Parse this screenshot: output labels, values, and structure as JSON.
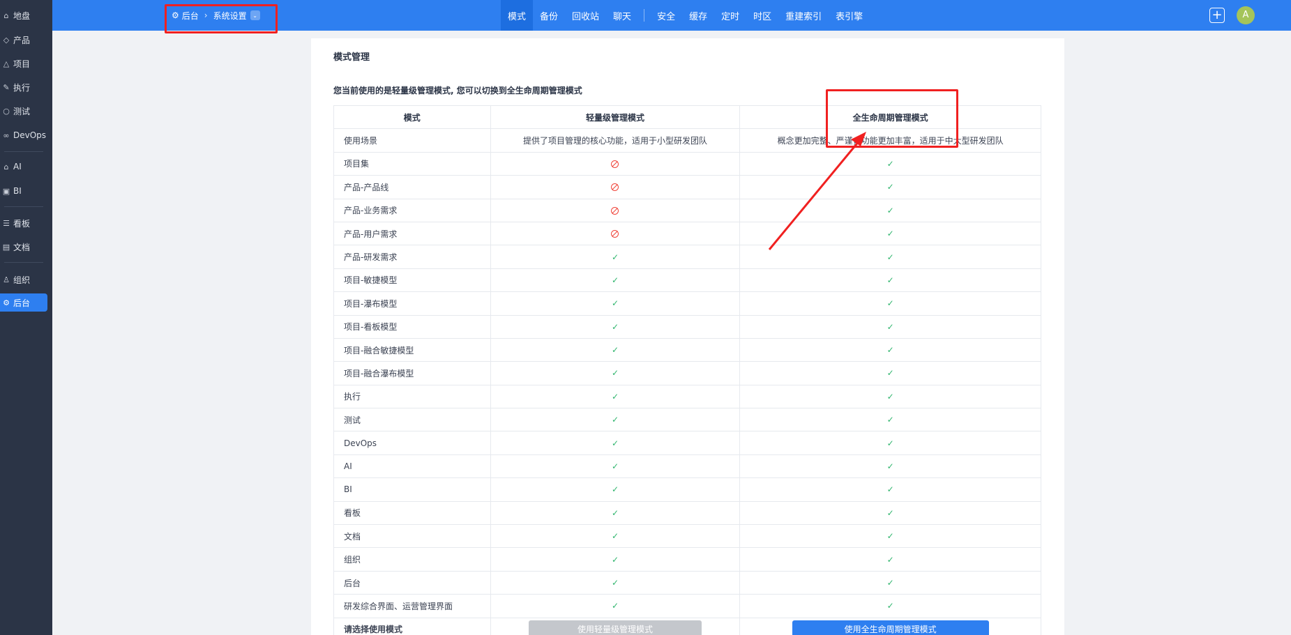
{
  "sidebar": {
    "items": [
      {
        "icon": "home-icon",
        "glyph": "⌂",
        "label": "地盘"
      },
      {
        "icon": "product-icon",
        "glyph": "◇",
        "label": "产品"
      },
      {
        "icon": "project-icon",
        "glyph": "△",
        "label": "项目"
      },
      {
        "icon": "execution-icon",
        "glyph": "✎",
        "label": "执行"
      },
      {
        "icon": "test-icon",
        "glyph": "○",
        "label": "测试"
      },
      {
        "icon": "devops-icon",
        "glyph": "∞",
        "label": "DevOps"
      },
      {
        "icon": "ai-icon",
        "glyph": "⌂",
        "label": "AI"
      },
      {
        "icon": "bi-icon",
        "glyph": "▣",
        "label": "BI"
      },
      {
        "icon": "kanban-icon",
        "glyph": "☰",
        "label": "看板"
      },
      {
        "icon": "doc-icon",
        "glyph": "▤",
        "label": "文档"
      },
      {
        "icon": "org-icon",
        "glyph": "♙",
        "label": "组织"
      },
      {
        "icon": "admin-gear-icon",
        "glyph": "⚙",
        "label": "后台"
      }
    ],
    "active": "后台"
  },
  "breadcrumb": {
    "gear": "⚙",
    "root": "后台",
    "separator": "›",
    "current": "系统设置",
    "chevron": "⌄"
  },
  "topnav": {
    "group1": [
      "模式",
      "备份",
      "回收站",
      "聊天"
    ],
    "group2": [
      "安全",
      "缓存",
      "定时",
      "时区",
      "重建索引",
      "表引擎"
    ],
    "active": "模式",
    "plus": "+",
    "avatar": "A"
  },
  "panel": {
    "title": "模式管理",
    "description": "您当前使用的是轻量级管理模式, 您可以切换到全生命周期管理模式"
  },
  "table": {
    "headers": [
      "模式",
      "轻量级管理模式",
      "全生命周期管理模式"
    ],
    "scenario": {
      "label": "使用场景",
      "light": "提供了项目管理的核心功能，适用于小型研发团队",
      "full": "概念更加完整、严谨，功能更加丰富，适用于中大型研发团队"
    },
    "rows": [
      {
        "name": "项目集",
        "light": false,
        "full": true
      },
      {
        "name": "产品-产品线",
        "light": false,
        "full": true
      },
      {
        "name": "产品-业务需求",
        "light": false,
        "full": true
      },
      {
        "name": "产品-用户需求",
        "light": false,
        "full": true
      },
      {
        "name": "产品-研发需求",
        "light": true,
        "full": true
      },
      {
        "name": "项目-敏捷模型",
        "light": true,
        "full": true
      },
      {
        "name": "项目-瀑布模型",
        "light": true,
        "full": true
      },
      {
        "name": "项目-看板模型",
        "light": true,
        "full": true
      },
      {
        "name": "项目-融合敏捷模型",
        "light": true,
        "full": true
      },
      {
        "name": "项目-融合瀑布模型",
        "light": true,
        "full": true
      },
      {
        "name": "执行",
        "light": true,
        "full": true
      },
      {
        "name": "测试",
        "light": true,
        "full": true
      },
      {
        "name": "DevOps",
        "light": true,
        "full": true
      },
      {
        "name": "AI",
        "light": true,
        "full": true
      },
      {
        "name": "BI",
        "light": true,
        "full": true
      },
      {
        "name": "看板",
        "light": true,
        "full": true
      },
      {
        "name": "文档",
        "light": true,
        "full": true
      },
      {
        "name": "组织",
        "light": true,
        "full": true
      },
      {
        "name": "后台",
        "light": true,
        "full": true
      },
      {
        "name": "研发综合界面、运营管理界面",
        "light": true,
        "full": true
      }
    ],
    "check_glyph": "✓",
    "footer": {
      "label": "请选择使用模式",
      "light_button": "使用轻量级管理模式",
      "full_button": "使用全生命周期管理模式"
    }
  },
  "colors": {
    "topbar": "#2e7ff0",
    "sidebar": "#2b3446",
    "check": "#2fb56d",
    "forbidden": "#f0443a",
    "highlight": "#f02020"
  }
}
